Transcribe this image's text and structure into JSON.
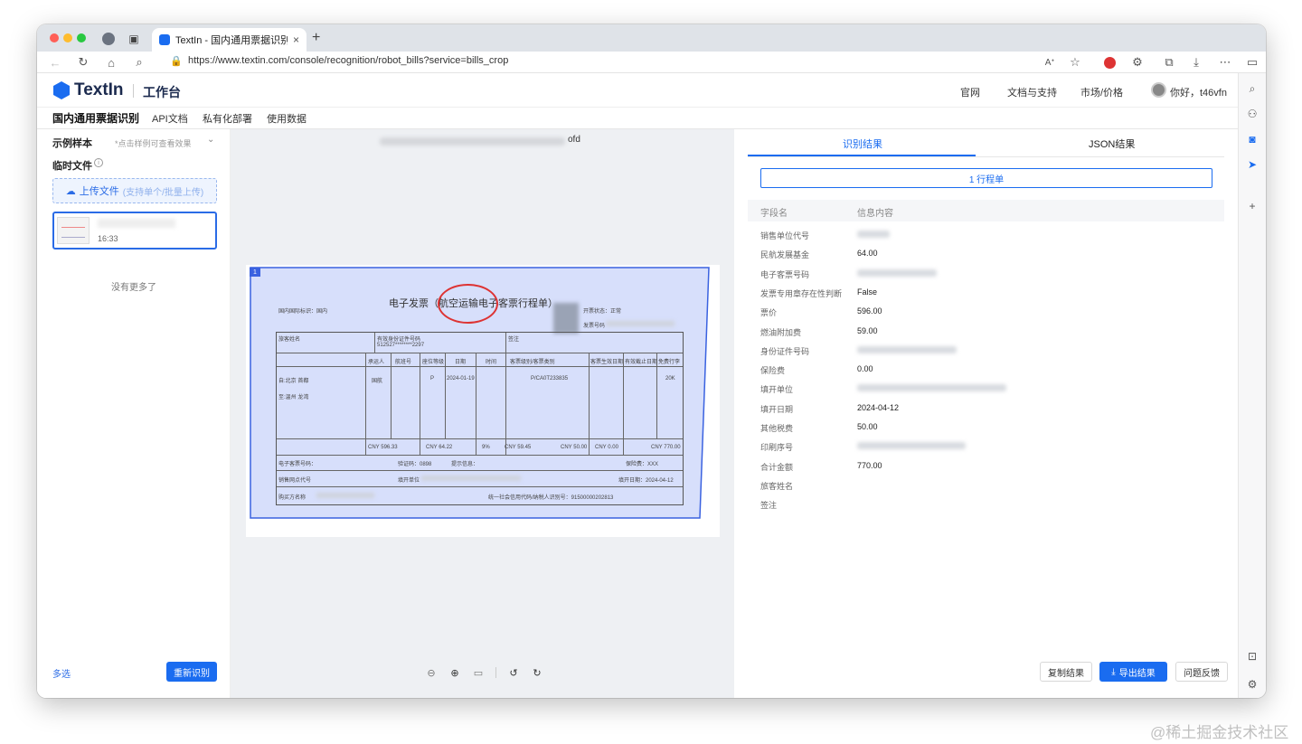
{
  "browser": {
    "tab_title": "TextIn - 国内通用票据识别",
    "url": "https://www.textin.com/console/recognition/robot_bills?service=bills_crop",
    "nav_icons": [
      "back-icon",
      "reload-icon",
      "home-icon",
      "search-icon"
    ]
  },
  "header": {
    "logo": "TextIn",
    "workspace": "工作台",
    "nav": [
      "官网",
      "文档与支持",
      "市场/价格"
    ],
    "greeting": "你好，t46vfn"
  },
  "subnav": {
    "items": [
      "国内通用票据识别",
      "API文档",
      "私有化部署",
      "使用数据"
    ]
  },
  "left": {
    "examples_title": "示例样本",
    "examples_hint": "*点击样例可查看效果",
    "temp_title": "临时文件",
    "upload_label": "上传文件",
    "upload_sub": "(支持单个/批量上传)",
    "file_time": "16:33",
    "no_more": "没有更多了",
    "multi_select": "多选",
    "re_recognize": "重新识别"
  },
  "center": {
    "doc_suffix": "ofd",
    "overlay_index": "1",
    "invoice": {
      "title": "电子发票（航空运输电子客票行程单）",
      "intl_label": "国内国际标识：国内",
      "status_label": "开票状态：正常",
      "invoice_no_label": "发票号码",
      "passenger_label": "旅客姓名",
      "id_label": "有效身份证件号码",
      "id_value": "512527********2297",
      "endorse_label": "签注",
      "col_carrier": "承运人",
      "col_flight": "航班号",
      "col_class": "座位等级",
      "col_date": "日期",
      "col_time": "时间",
      "col_fare_type": "客票级别/客票类别",
      "col_valid_from": "客票生效日期",
      "col_valid_to": "有效截止日期",
      "col_baggage": "免费行李",
      "from": "自:北京 首都",
      "to": "至:温州 龙湾",
      "carrier": "国航",
      "class": "P",
      "date": "2024-01-19",
      "fare_basis": "P/CA0T233835",
      "baggage": "20K",
      "fare": "CNY 596.33",
      "fuel": "CNY 64.22",
      "vat_rate": "9%",
      "vat": "CNY 59.45",
      "caac_fund": "CNY 50.00",
      "other_tax": "CNY 0.00",
      "total": "CNY 770.00",
      "ticket_no_label": "电子客票号码：",
      "check_code": "验证码：0898",
      "prompt": "提示信息：",
      "insurance": "保险费：XXX",
      "agent_label": "销售网点代号",
      "issuer_label": "填开单位",
      "issue_date": "填开日期：2024-04-12",
      "buyer_label": "购买方名称",
      "buyer_tax_id": "统一社会信用代码/纳税人识别号：91500000202813"
    },
    "zoom_icons": [
      "zoom-out-icon",
      "zoom-in-icon",
      "fit-icon",
      "rotate-left-icon",
      "rotate-right-icon"
    ]
  },
  "right": {
    "tabs": [
      "识别结果",
      "JSON结果"
    ],
    "result_select": "1 行程单",
    "head_field": "字段名",
    "head_value": "信息内容",
    "fields": [
      {
        "label": "销售单位代号",
        "value": "",
        "blur": true
      },
      {
        "label": "民航发展基金",
        "value": "64.00",
        "blur": false
      },
      {
        "label": "电子客票号码",
        "value": "",
        "blur": true
      },
      {
        "label": "发票专用章存在性判断",
        "value": "False",
        "blur": false
      },
      {
        "label": "票价",
        "value": "596.00",
        "blur": false
      },
      {
        "label": "燃油附加费",
        "value": "59.00",
        "blur": false
      },
      {
        "label": "身份证件号码",
        "value": "",
        "blur": true
      },
      {
        "label": "保险费",
        "value": "0.00",
        "blur": false
      },
      {
        "label": "填开单位",
        "value": "",
        "blur": true
      },
      {
        "label": "填开日期",
        "value": "2024-04-12",
        "blur": false
      },
      {
        "label": "其他税费",
        "value": "50.00",
        "blur": false
      },
      {
        "label": "印刷序号",
        "value": "",
        "blur": true
      },
      {
        "label": "合计金额",
        "value": "770.00",
        "blur": false
      },
      {
        "label": "旅客姓名",
        "value": "",
        "blur": false
      },
      {
        "label": "签注",
        "value": "",
        "blur": false
      }
    ],
    "copy_result": "复制结果",
    "export_result": "导出结果",
    "feedback": "问题反馈"
  },
  "watermark": "@稀土掘金技术社区",
  "colors": {
    "accent": "#1a6cf0",
    "overlay": "#3a62e0",
    "stamp": "#d33333"
  }
}
